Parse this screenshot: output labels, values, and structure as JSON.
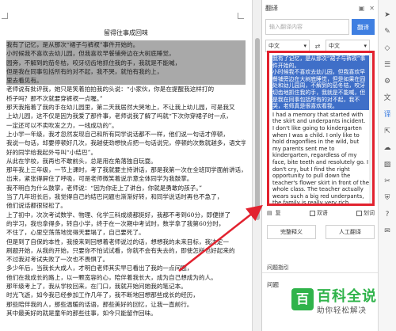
{
  "document": {
    "title": "留得往事成回味",
    "lines": [
      {
        "text": "我有了记忆，是从那次“裙子与裤衩”事件开始的。",
        "selected": true
      },
      {
        "text": "小时候我不喜欢去幼儿园，但我喜欢早餐铺旁边在大树底睡觉，",
        "selected": true
      },
      {
        "text": "园旁，不解到的茄冬桔，咬牙切齿地抓住我的手，我就是不能喊，",
        "selected": true
      },
      {
        "text": "但是我在同事包括所有的对不起，我不哭，就怕有我的上，",
        "selected": true
      },
      {
        "text": "里去看见有。",
        "selected": true
      },
      {
        "text": "老师说有批评我，她只是笑着拍拍我的头说：“小家伙，你是在提醒我这样打的",
        "selected": false
      },
      {
        "text": "桥子吗？那不次就要穿裤衩一点喔。”",
        "selected": false
      },
      {
        "text": "那天我拖着了我的手在幼儿园里，第二天我居然大哭地上，不让我上幼儿园，可是我又",
        "selected": false
      },
      {
        "text": "上幼儿园，这不仅是因为我爱了那件事，老师说我了解了吗就“下次你穿裙子时一点，",
        "selected": false
      },
      {
        "text": "一定还可以不卖吹发之力，一线成功的”。",
        "selected": false
      },
      {
        "text": "上小学一年级，我才忽然发现自己和所有同学说话都不一样，他们说一句话才停顿，",
        "selected": false
      },
      {
        "text": "我说一句话，却要停顿好几次，我越使劲想快点把一句话说完，停顿的次数就越多，语文学",
        "selected": false
      },
      {
        "text": "好的同学给我起外号叫“小结巴”。",
        "selected": false
      },
      {
        "text": "从此在学校，我再也不敢前头，总是用在角落独自玩耍。",
        "selected": false
      },
      {
        "text": "那年我上三年级，一节上课时，考了我就要主持讲话，那是我第一次在全班同学面前讲话，话说",
        "selected": false
      },
      {
        "text": "出来，紧张得屏住了呼吸，可是老师微笑着说示意全体同学为我鼓掌。",
        "selected": false
      },
      {
        "text": "我不明白为什么鼓掌，老师说：“因为你走上了讲台，你就是勇敢的孩子。”",
        "selected": false
      },
      {
        "text": "当了几年班长后，我觉得自己的结巴问题也渐渐好转，和同学说话时再也不急了，",
        "selected": false
      },
      {
        "text": "他们说话都很轻松了。",
        "selected": false
      },
      {
        "text": "上了初中，次次考试数学、物理、化学三科成绩都挺好，我都不考到60分，即便拼了",
        "selected": false
      },
      {
        "text": "的学习，我也拿得多，转自小学，终于在一次期中考试时，数学拿了我第60分时，",
        "selected": false
      },
      {
        "text": "不住了，心里空荡荡地觉得天要塌了，自己要死了。",
        "selected": false
      },
      {
        "text": "但是到了自保的本性，我接来到回想着老师说过的话，想想我的未来目标，我决定一",
        "selected": false
      },
      {
        "text": "刷题开始，从我的开始，只要你不怕试试看，你就不会有失去的，即使怎样也好起来的",
        "selected": false
      },
      {
        "text": "不过我对考试失败了一次也不畏惧了。",
        "selected": false
      },
      {
        "text": "多少年后，当我长大成人，才明白老师其实早已看出了我的一点问题，",
        "selected": false
      },
      {
        "text": "他们在我成长的路上，以一颗宽容的心，陪伴着我长大，成为自己想成为的人。",
        "selected": false
      },
      {
        "text": "那年级考上了，我从学校回来，在门口，我就开始问她我的笔记本。",
        "selected": false
      },
      {
        "text": "时光飞逝，如今我已经参加工作几年了，我不断地回想那些成长的经历，",
        "selected": false
      },
      {
        "text": "那些陪伴我的人，那些温暖的话语，那些美好的回忆，让我一直前行。",
        "selected": false
      },
      {
        "text": "其中最美好的就是童年的那些往事，如今只能留作回味。",
        "selected": false
      }
    ]
  },
  "panel": {
    "title": "翻译",
    "search_placeholder": "输入翻译内容",
    "translate_label": "翻译",
    "source_lang": "中文",
    "target_lang": "中文",
    "result_zh": "我有了记忆，是从那次“裙子与裤衩”事件开始的。\n小时候我不喜欢去幼儿园，但我喜欢早餐铺旁边在大树底睡觉，但是如果在园处和幼儿园周，不解到的茄冬桔，咬牙切齿地抓住我的手，我就是不能喊，但是我在同事包括所有的对不起，我不哭，老师真是很喜欢看我。",
    "result_en": "I had a memory that started with the skirt and underpants incident.\nI don't like going to kindergarten when I was a child. I only like to hold dragonflies in the wild, but my parents sent me to kindergarten, regardless of my face, bite teeth and resolutely go. I don't cry, but I find the right opportunity to pull down the teacher's flower skirt in front of the whole class. The teacher actually wears such a big red underpants, the family is really very rich.",
    "tools": {
      "copy_label": "复",
      "chk1_label": "双语",
      "chk2_label": "划词"
    },
    "buttons": {
      "polish": "完整释义",
      "human": "人工翻译"
    },
    "ask_title": "问题指引",
    "ask_label": "问题"
  },
  "watermark": {
    "logo": "百",
    "title": "百科全说",
    "subtitle": "助你轻松解决"
  },
  "colors": {
    "accent": "#3f7fe1",
    "annotation": "#e2222f",
    "watermark": "#2fb34a"
  }
}
